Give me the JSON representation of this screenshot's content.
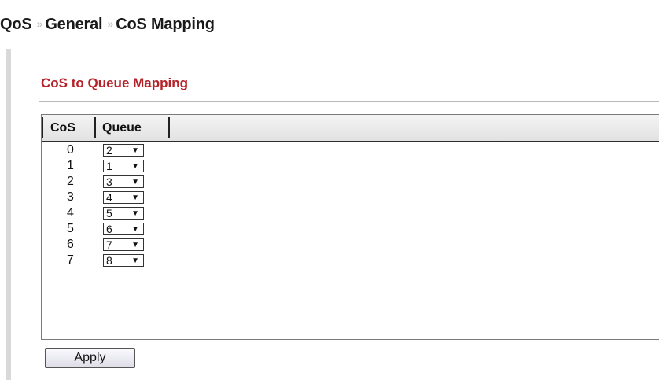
{
  "breadcrumb": [
    "QoS",
    "General",
    "CoS Mapping"
  ],
  "breadcrumb_separator": "»",
  "section": {
    "title": "CoS to Queue Mapping"
  },
  "table": {
    "columns": [
      "CoS",
      "Queue"
    ],
    "rows": [
      {
        "cos": "0",
        "queue": "2"
      },
      {
        "cos": "1",
        "queue": "1"
      },
      {
        "cos": "2",
        "queue": "3"
      },
      {
        "cos": "3",
        "queue": "4"
      },
      {
        "cos": "4",
        "queue": "5"
      },
      {
        "cos": "5",
        "queue": "6"
      },
      {
        "cos": "6",
        "queue": "7"
      },
      {
        "cos": "7",
        "queue": "8"
      }
    ]
  },
  "dropdown_arrow": "▼",
  "apply_label": "Apply",
  "colors": {
    "section_title": "#b5232a",
    "separator": "#c8c8c8"
  }
}
